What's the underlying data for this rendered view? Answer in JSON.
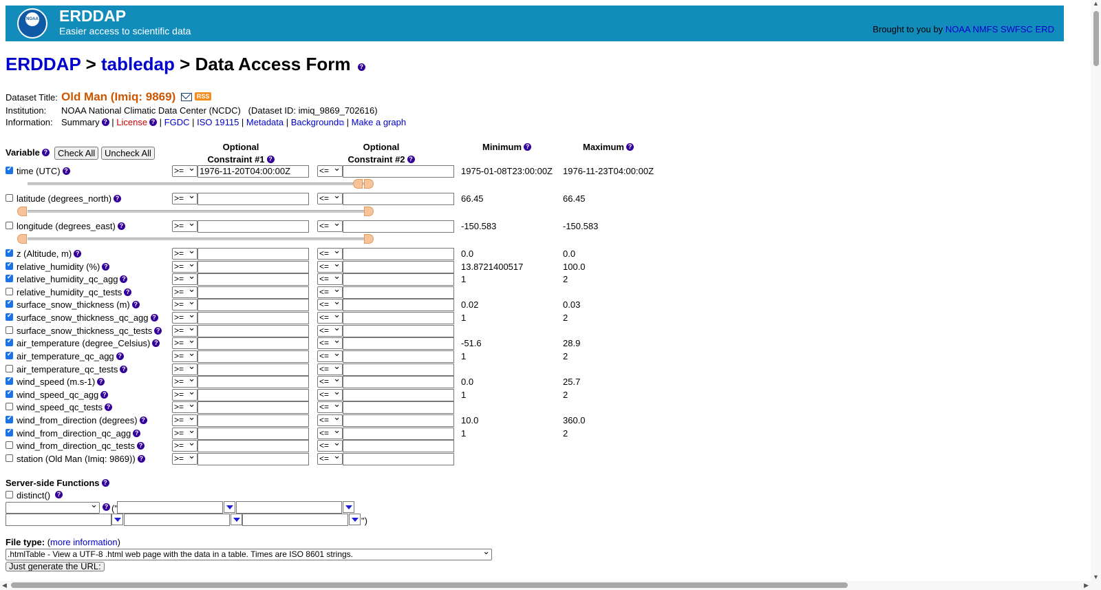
{
  "banner": {
    "logo_text": "NOAA",
    "title": "ERDDAP",
    "subtitle": "Easier access to scientific data",
    "brought_by": "Brought to you by",
    "brought_link": "NOAA NMFS SWFSC ERD"
  },
  "breadcrumb": {
    "item1": "ERDDAP",
    "sep": ">",
    "item2": "tabledap",
    "current": "Data Access Form"
  },
  "dataset": {
    "title_label": "Dataset Title:",
    "title": "Old Man (Imiq: 9869)",
    "rss": "RSS",
    "institution_label": "Institution:",
    "institution": "NOAA National Climatic Data Center (NCDC)",
    "dataset_id": "(Dataset ID: imiq_9869_702616)",
    "information_label": "Information:",
    "links": {
      "summary": "Summary",
      "license": "License",
      "fgdc": "FGDC",
      "iso": "ISO 19115",
      "metadata": "Metadata",
      "background": "Background",
      "graph": "Make a graph"
    }
  },
  "table_header": {
    "variable": "Variable",
    "check_all": "Check All",
    "uncheck_all": "Uncheck All",
    "optional": "Optional",
    "constraint1": "Constraint #1",
    "constraint2": "Constraint #2",
    "minimum": "Minimum",
    "maximum": "Maximum"
  },
  "operators": {
    "ge": ">=",
    "le": "<="
  },
  "variables": [
    {
      "name": "time (UTC)",
      "checked": true,
      "c1": "1976-11-20T04:00:00Z",
      "min": "1975-01-08T23:00:00Z",
      "max": "1976-11-23T04:00:00Z"
    },
    {
      "name": "latitude (degrees_north)",
      "checked": false,
      "c1": "",
      "min": "66.45",
      "max": "66.45"
    },
    {
      "name": "longitude (degrees_east)",
      "checked": false,
      "c1": "",
      "min": "-150.583",
      "max": "-150.583"
    },
    {
      "name": "z (Altitude, m)",
      "checked": true,
      "c1": "",
      "min": "0.0",
      "max": "0.0"
    },
    {
      "name": "relative_humidity (%)",
      "checked": true,
      "c1": "",
      "min": "13.8721400517",
      "max": "100.0"
    },
    {
      "name": "relative_humidity_qc_agg",
      "checked": true,
      "c1": "",
      "min": "1",
      "max": "2"
    },
    {
      "name": "relative_humidity_qc_tests",
      "checked": false,
      "c1": "",
      "min": "",
      "max": ""
    },
    {
      "name": "surface_snow_thickness (m)",
      "checked": true,
      "c1": "",
      "min": "0.02",
      "max": "0.03"
    },
    {
      "name": "surface_snow_thickness_qc_agg",
      "checked": true,
      "c1": "",
      "min": "1",
      "max": "2"
    },
    {
      "name": "surface_snow_thickness_qc_tests",
      "checked": false,
      "c1": "",
      "min": "",
      "max": ""
    },
    {
      "name": "air_temperature (degree_Celsius)",
      "checked": true,
      "c1": "",
      "min": "-51.6",
      "max": "28.9"
    },
    {
      "name": "air_temperature_qc_agg",
      "checked": true,
      "c1": "",
      "min": "1",
      "max": "2"
    },
    {
      "name": "air_temperature_qc_tests",
      "checked": false,
      "c1": "",
      "min": "",
      "max": ""
    },
    {
      "name": "wind_speed (m.s-1)",
      "checked": true,
      "c1": "",
      "min": "0.0",
      "max": "25.7"
    },
    {
      "name": "wind_speed_qc_agg",
      "checked": true,
      "c1": "",
      "min": "1",
      "max": "2"
    },
    {
      "name": "wind_speed_qc_tests",
      "checked": false,
      "c1": "",
      "min": "",
      "max": ""
    },
    {
      "name": "wind_from_direction (degrees)",
      "checked": true,
      "c1": "",
      "min": "10.0",
      "max": "360.0"
    },
    {
      "name": "wind_from_direction_qc_agg",
      "checked": true,
      "c1": "",
      "min": "1",
      "max": "2"
    },
    {
      "name": "wind_from_direction_qc_tests",
      "checked": false,
      "c1": "",
      "min": "",
      "max": ""
    },
    {
      "name": "station (Old Man (Imiq: 9869))",
      "checked": false,
      "c1": "",
      "min": "",
      "max": ""
    }
  ],
  "server_functions": {
    "title": "Server-side Functions",
    "distinct": "distinct()",
    "open_paren": "(\"",
    "close_paren": "\")"
  },
  "file_type": {
    "label": "File type:",
    "more_open": "(",
    "more_info": "more information",
    "more_close": ")",
    "selected": ".htmlTable - View a UTF-8 .html web page with the data in a table. Times are ISO 8601 strings."
  },
  "generate_button": "Just generate the URL:",
  "icons": {
    "question": "?",
    "external": "⧉"
  }
}
